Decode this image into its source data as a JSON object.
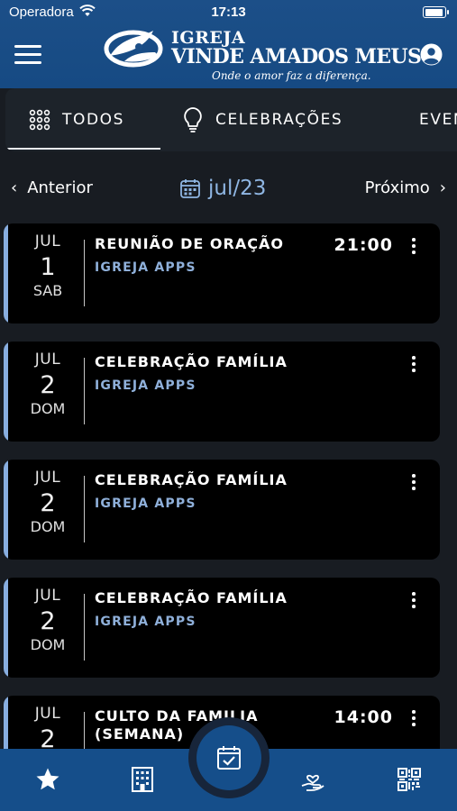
{
  "status_bar": {
    "carrier": "Operadora",
    "time": "17:13"
  },
  "app_bar": {
    "logo": {
      "line1": "IGREJA",
      "line2": "VINDE AMADOS MEUS",
      "tagline": "Onde o amor faz a diferença."
    }
  },
  "tabs": [
    {
      "label": "TODOS",
      "active": true,
      "icon": "grid-dots-icon"
    },
    {
      "label": "CELEBRAÇÕES",
      "active": false,
      "icon": "lightbulb-icon"
    },
    {
      "label": "EVENTOS",
      "active": false,
      "icon": "calendar-icon"
    }
  ],
  "month_nav": {
    "prev_label": "Anterior",
    "next_label": "Próximo",
    "current": "jul/23"
  },
  "events": [
    {
      "month": "JUL",
      "day": "1",
      "weekday": "SAB",
      "title": "REUNIÃO DE ORAÇÃO",
      "org": "IGREJA APPS",
      "time": "21:00"
    },
    {
      "month": "JUL",
      "day": "2",
      "weekday": "DOM",
      "title": "CELEBRAÇÃO FAMÍLIA",
      "org": "IGREJA APPS",
      "time": ""
    },
    {
      "month": "JUL",
      "day": "2",
      "weekday": "DOM",
      "title": "CELEBRAÇÃO FAMÍLIA",
      "org": "IGREJA APPS",
      "time": ""
    },
    {
      "month": "JUL",
      "day": "2",
      "weekday": "DOM",
      "title": "CELEBRAÇÃO FAMÍLIA",
      "org": "IGREJA APPS",
      "time": ""
    },
    {
      "month": "JUL",
      "day": "2",
      "weekday": "",
      "title": "CULTO DA FAMILIA (SEMANA)",
      "org": "",
      "time": "14:00"
    }
  ],
  "bottom_nav": [
    {
      "icon": "star-icon"
    },
    {
      "icon": "building-icon"
    },
    {
      "icon": "calendar-check-icon",
      "active": true
    },
    {
      "icon": "hand-heart-icon"
    },
    {
      "icon": "qr-code-icon"
    }
  ],
  "colors": {
    "primary": "#154e8a",
    "accent": "#88aee0",
    "background": "#181c22",
    "card": "#000000"
  }
}
